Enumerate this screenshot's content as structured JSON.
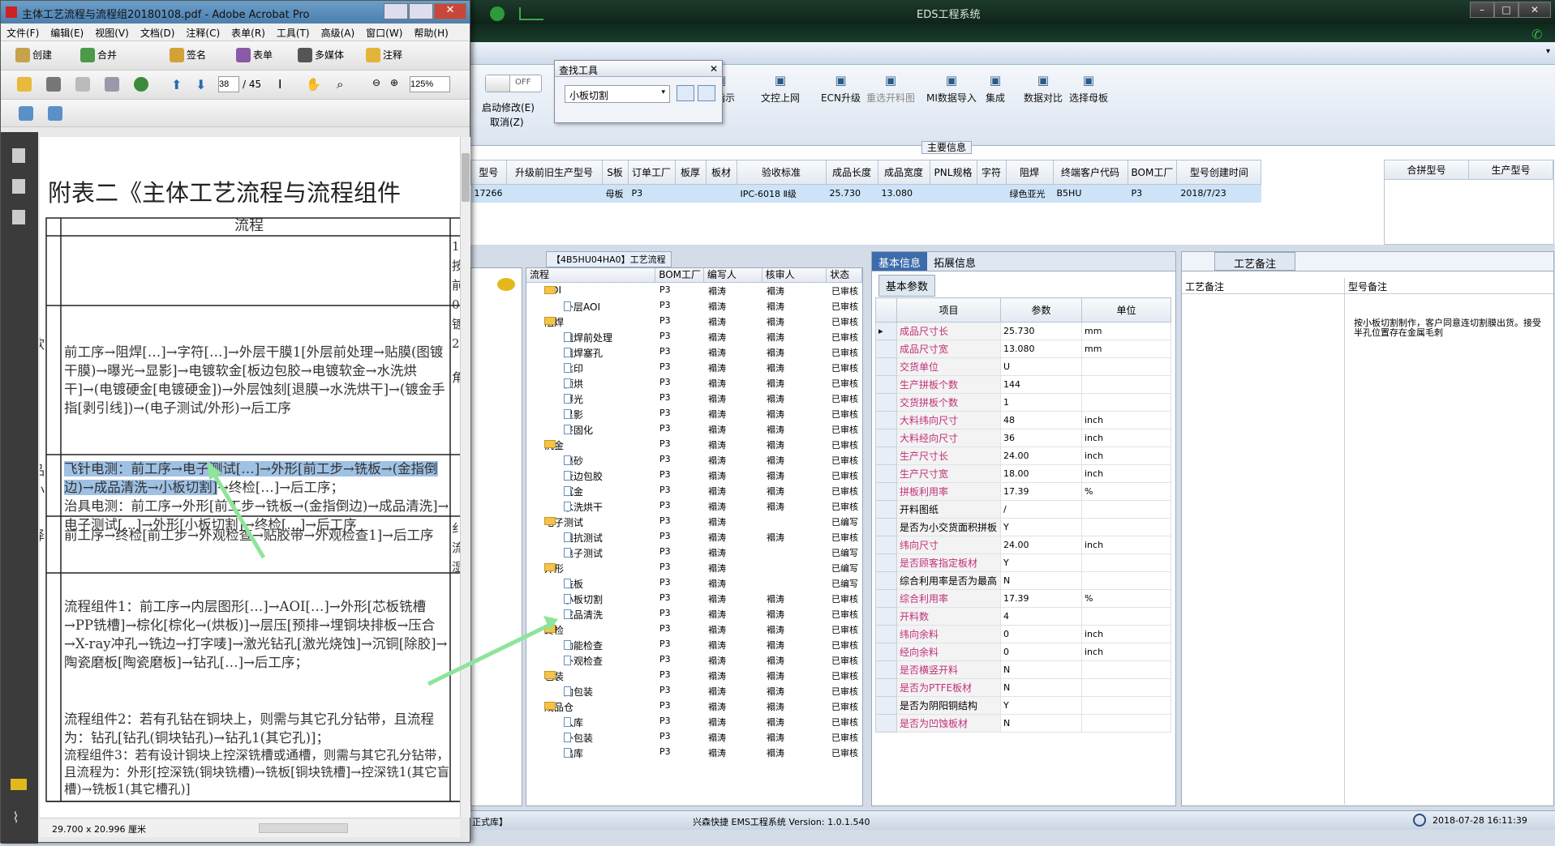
{
  "eds": {
    "title": "EDS工程系统",
    "switch_label": "OFF",
    "auto_modify": "启动修改(E)",
    "cancel": "取消(Z)",
    "finder": {
      "title": "查找工具",
      "value": "小板切割"
    },
    "ribbon": [
      {
        "icon": "send-icon",
        "label": "送指示",
        "disabled": false
      },
      {
        "icon": "upload-icon",
        "label": "文控上网",
        "disabled": false
      },
      {
        "icon": "ecn-icon",
        "label": "ECN升级",
        "disabled": false
      },
      {
        "icon": "image-icon",
        "label": "重选开料图",
        "disabled": true
      },
      {
        "icon": "import-icon",
        "label": "MI数据导入",
        "disabled": false
      },
      {
        "icon": "integrate-icon",
        "label": "集成",
        "disabled": false
      },
      {
        "icon": "compare-icon",
        "label": "数据对比",
        "disabled": false
      },
      {
        "icon": "shuffle-icon",
        "label": "选择母板",
        "disabled": false
      }
    ],
    "main_section": "主要信息",
    "main_columns": [
      "型号",
      "升级前旧生产型号",
      "S板",
      "订单工厂",
      "板厚",
      "板材",
      "验收标准",
      "成品长度",
      "成品宽度",
      "PNL规格",
      "字符",
      "阻焊",
      "终端客户代码",
      "BOM工厂",
      "型号创建时间"
    ],
    "main_row": [
      "17266",
      "",
      "母板",
      "P3",
      "",
      "",
      "IPC-6018 Ⅱ级",
      "25.730",
      "13.080",
      "",
      "",
      "绿色亚光",
      "B5HU",
      "P3",
      "2018/7/23"
    ],
    "side_columns": [
      "合拼型号",
      "生产型号"
    ],
    "process_header": "【4B5HU04HA0】工艺流程",
    "process_columns": [
      "流程",
      "BOM工厂",
      "编写人",
      "核审人",
      "状态"
    ],
    "process_rows": [
      {
        "name": "AOI",
        "level": 1,
        "type": "folder",
        "bom": "P3",
        "writer": "褟涛",
        "reviewer": "褟涛",
        "status": "已审核"
      },
      {
        "name": "外层AOI",
        "level": 2,
        "type": "doc",
        "bom": "P3",
        "writer": "褟涛",
        "reviewer": "褟涛",
        "status": "已审核"
      },
      {
        "name": "阻焊",
        "level": 1,
        "type": "folder",
        "bom": "P3",
        "writer": "褟涛",
        "reviewer": "褟涛",
        "status": "已审核"
      },
      {
        "name": "阻焊前处理",
        "level": 2,
        "type": "doc",
        "bom": "P3",
        "writer": "褟涛",
        "reviewer": "褟涛",
        "status": "已审核"
      },
      {
        "name": "阻焊塞孔",
        "level": 2,
        "type": "doc",
        "bom": "P3",
        "writer": "褟涛",
        "reviewer": "褟涛",
        "status": "已审核"
      },
      {
        "name": "丝印",
        "level": 2,
        "type": "doc",
        "bom": "P3",
        "writer": "褟涛",
        "reviewer": "褟涛",
        "status": "已审核"
      },
      {
        "name": "预烘",
        "level": 2,
        "type": "doc",
        "bom": "P3",
        "writer": "褟涛",
        "reviewer": "褟涛",
        "status": "已审核"
      },
      {
        "name": "曝光",
        "level": 2,
        "type": "doc",
        "bom": "P3",
        "writer": "褟涛",
        "reviewer": "褟涛",
        "status": "已审核"
      },
      {
        "name": "显影",
        "level": 2,
        "type": "doc",
        "bom": "P3",
        "writer": "褟涛",
        "reviewer": "褟涛",
        "status": "已审核"
      },
      {
        "name": "终固化",
        "level": 2,
        "type": "doc",
        "bom": "P3",
        "writer": "褟涛",
        "reviewer": "褟涛",
        "status": "已审核"
      },
      {
        "name": "沉金",
        "level": 1,
        "type": "folder",
        "bom": "P3",
        "writer": "褟涛",
        "reviewer": "褟涛",
        "status": "已审核"
      },
      {
        "name": "喷砂",
        "level": 2,
        "type": "doc",
        "bom": "P3",
        "writer": "褟涛",
        "reviewer": "褟涛",
        "status": "已审核"
      },
      {
        "name": "板边包胶",
        "level": 2,
        "type": "doc",
        "bom": "P3",
        "writer": "褟涛",
        "reviewer": "褟涛",
        "status": "已审核"
      },
      {
        "name": "沉金",
        "level": 2,
        "type": "doc",
        "bom": "P3",
        "writer": "褟涛",
        "reviewer": "褟涛",
        "status": "已审核"
      },
      {
        "name": "水洗烘干",
        "level": 2,
        "type": "doc",
        "bom": "P3",
        "writer": "褟涛",
        "reviewer": "褟涛",
        "status": "已审核"
      },
      {
        "name": "电子测试",
        "level": 1,
        "type": "folder",
        "bom": "P3",
        "writer": "褟涛",
        "reviewer": "",
        "status": "已编写"
      },
      {
        "name": "阻抗测试",
        "level": 2,
        "type": "doc",
        "bom": "P3",
        "writer": "褟涛",
        "reviewer": "褟涛",
        "status": "已审核"
      },
      {
        "name": "电子测试",
        "level": 2,
        "type": "doc",
        "bom": "P3",
        "writer": "褟涛",
        "reviewer": "",
        "status": "已编写"
      },
      {
        "name": "外形",
        "level": 1,
        "type": "folder",
        "bom": "P3",
        "writer": "褟涛",
        "reviewer": "",
        "status": "已编写"
      },
      {
        "name": "铣板",
        "level": 2,
        "type": "doc",
        "bom": "P3",
        "writer": "褟涛",
        "reviewer": "",
        "status": "已编写"
      },
      {
        "name": "小板切割",
        "level": 2,
        "type": "doc",
        "bom": "P3",
        "writer": "褟涛",
        "reviewer": "褟涛",
        "status": "已审核"
      },
      {
        "name": "成品清洗",
        "level": 2,
        "type": "doc",
        "bom": "P3",
        "writer": "褟涛",
        "reviewer": "褟涛",
        "status": "已审核"
      },
      {
        "name": "终检",
        "level": 1,
        "type": "folder",
        "bom": "P3",
        "writer": "褟涛",
        "reviewer": "褟涛",
        "status": "已审核"
      },
      {
        "name": "功能检查",
        "level": 2,
        "type": "doc",
        "bom": "P3",
        "writer": "褟涛",
        "reviewer": "褟涛",
        "status": "已审核"
      },
      {
        "name": "外观检查",
        "level": 2,
        "type": "doc",
        "bom": "P3",
        "writer": "褟涛",
        "reviewer": "褟涛",
        "status": "已审核"
      },
      {
        "name": "包装",
        "level": 1,
        "type": "folder",
        "bom": "P3",
        "writer": "褟涛",
        "reviewer": "褟涛",
        "status": "已审核"
      },
      {
        "name": "内包装",
        "level": 2,
        "type": "doc",
        "bom": "P3",
        "writer": "褟涛",
        "reviewer": "褟涛",
        "status": "已审核"
      },
      {
        "name": "成品仓",
        "level": 1,
        "type": "folder",
        "bom": "P3",
        "writer": "褟涛",
        "reviewer": "褟涛",
        "status": "已审核"
      },
      {
        "name": "入库",
        "level": 2,
        "type": "doc",
        "bom": "P3",
        "writer": "褟涛",
        "reviewer": "褟涛",
        "status": "已审核"
      },
      {
        "name": "外包装",
        "level": 2,
        "type": "doc",
        "bom": "P3",
        "writer": "褟涛",
        "reviewer": "褟涛",
        "status": "已审核"
      },
      {
        "name": "出库",
        "level": 2,
        "type": "doc",
        "bom": "P3",
        "writer": "褟涛",
        "reviewer": "褟涛",
        "status": "已审核"
      }
    ],
    "info_tabs": [
      "基本信息",
      "拓展信息"
    ],
    "basic_params_tab": "基本参数",
    "param_columns": [
      "项目",
      "参数",
      "单位"
    ],
    "params": [
      {
        "item": "成品尺寸长",
        "value": "25.730",
        "unit": "mm",
        "pink": true
      },
      {
        "item": "成品尺寸宽",
        "value": "13.080",
        "unit": "mm",
        "pink": true
      },
      {
        "item": "交货单位",
        "value": "U",
        "unit": "",
        "pink": true
      },
      {
        "item": "生产拼板个数",
        "value": "144",
        "unit": "",
        "pink": true
      },
      {
        "item": "交货拼板个数",
        "value": "1",
        "unit": "",
        "pink": true
      },
      {
        "item": "大料纬向尺寸",
        "value": "48",
        "unit": "inch",
        "pink": true
      },
      {
        "item": "大料经向尺寸",
        "value": "36",
        "unit": "inch",
        "pink": true
      },
      {
        "item": "生产尺寸长",
        "value": "24.00",
        "unit": "inch",
        "pink": true
      },
      {
        "item": "生产尺寸宽",
        "value": "18.00",
        "unit": "inch",
        "pink": true
      },
      {
        "item": "拼板利用率",
        "value": "17.39",
        "unit": "%",
        "pink": true
      },
      {
        "item": "开料图纸",
        "value": "/",
        "unit": "",
        "pink": false
      },
      {
        "item": "是否为小交货面积拼板",
        "value": "Y",
        "unit": "",
        "pink": false
      },
      {
        "item": "纬向尺寸",
        "value": "24.00",
        "unit": "inch",
        "pink": true
      },
      {
        "item": "是否顾客指定板材",
        "value": "Y",
        "unit": "",
        "pink": true
      },
      {
        "item": "综合利用率是否为最高",
        "value": "N",
        "unit": "",
        "pink": false
      },
      {
        "item": "综合利用率",
        "value": "17.39",
        "unit": "%",
        "pink": true
      },
      {
        "item": "开料数",
        "value": "4",
        "unit": "",
        "pink": true
      },
      {
        "item": "纬向余料",
        "value": "0",
        "unit": "inch",
        "pink": true
      },
      {
        "item": "经向余料",
        "value": "0",
        "unit": "inch",
        "pink": true
      },
      {
        "item": "是否横竖开料",
        "value": "N",
        "unit": "",
        "pink": true
      },
      {
        "item": "是否为PTFE板材",
        "value": "N",
        "unit": "",
        "pink": true
      },
      {
        "item": "是否为阴阳铜结构",
        "value": "Y",
        "unit": "",
        "pink": false
      },
      {
        "item": "是否为凹蚀板材",
        "value": "N",
        "unit": "",
        "pink": true
      }
    ],
    "remarks_tab": "工艺备注",
    "remarks_col1": "工艺备注",
    "remarks_col2": "型号备注",
    "model_remark": "按小板切割制作，客户同意连切割膜出货。接受半孔位置存在金属毛刺",
    "status": {
      "left": "正式库】",
      "center": "兴森快捷 EMS工程系统 Version: 1.0.1.540",
      "time": "2018-07-28 16:11:39"
    }
  },
  "acrobat": {
    "title": "主体工艺流程与流程组20180108.pdf - Adobe Acrobat Pro",
    "menu": [
      "文件(F)",
      "编辑(E)",
      "视图(V)",
      "文档(D)",
      "注释(C)",
      "表单(R)",
      "工具(T)",
      "高级(A)",
      "窗口(W)",
      "帮助(H)"
    ],
    "toolbar": [
      "创建",
      "合并",
      "签名",
      "表单",
      "多媒体",
      "注释"
    ],
    "page_num": "38",
    "page_total": "/ 45",
    "zoom": "125%",
    "doc_title": "附表二《主体工艺流程与流程组件",
    "col_header": "流程",
    "p1": "前工序→阻焊[…]→字符[…]→外层干膜1[外层前处理→贴膜(图镀干膜)→曝光→显影]→电镀软金[板边包胶→电镀软金→水洗烘干]→(电镀硬金[电镀硬金])→外层蚀刻[退膜→水洗烘干]→(镀金手指[剥引线])→(电子测试/外形)→后工序",
    "p2a": "飞针电测：前工序→电子测试[…]→外形[前工步→铣板→(金指倒边)→成品清洗→小板切割]",
    "p2b": "→终检[…]→后工序；",
    "p2c": "治具电测：前工序→外形[前工步→铣板→(金指倒边)→成品清洗]→电子测试[…]→外形[小板切割]→终检[…]→后工序",
    "p3": "前工序→终检[前工步→外观检查→贴胶带→外观检查1]→后工序",
    "p4": "流程组件1：前工序→内层图形[…]→AOI[…]→外形[芯板铣槽→PP铣槽]→棕化[棕化→(烘板)]→层压[预排→埋铜块排板→压合→X-ray冲孔→铣边→打字唛]→激光钻孔[激光烧蚀]→沉铜[除胶]→陶瓷磨板[陶瓷磨板]→钻孔[…]→后工序；",
    "p5": "流程组件2：若有孔钻在铜块上，则需与其它孔分钻带，且流程为：钻孔[钻孔(铜块钻孔)→钻孔1(其它孔)]；",
    "p6": "流程组件3：若有设计铜块上控深铣槽或通槽，则需与其它孔分钻带，且流程为：外形[控深铣(铜块铣槽)→铣板[铜块铣槽]→控深铣1(其它盲槽)→铣板1(其它槽孔)]",
    "left_frag": [
      "软",
      "品",
      "小",
      "择"
    ],
    "right_frag": [
      "1",
      "按",
      "前",
      "0",
      "镀",
      "2",
      "角",
      "纟",
      "流",
      "湿"
    ],
    "page_size": "29.700 x 20.996 厘米"
  }
}
